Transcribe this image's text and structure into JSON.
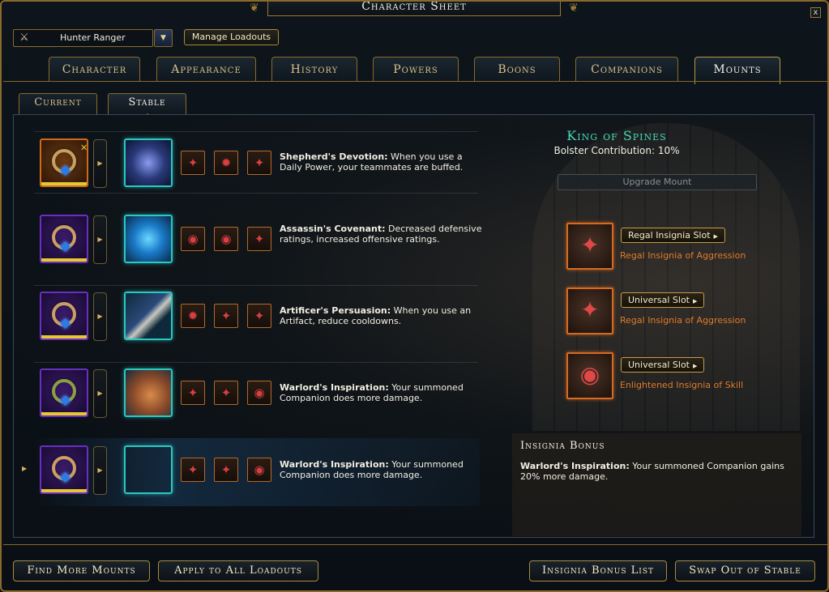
{
  "window": {
    "title": "Character Sheet",
    "close_glyph": "x"
  },
  "loadout": {
    "selected": "Hunter Ranger",
    "manage_label": "Manage Loadouts"
  },
  "tabs": [
    {
      "label": "Character"
    },
    {
      "label": "Appearance"
    },
    {
      "label": "History"
    },
    {
      "label": "Powers"
    },
    {
      "label": "Boons"
    },
    {
      "label": "Companions"
    },
    {
      "label": "Mounts",
      "active": true
    }
  ],
  "subtabs": [
    {
      "label": "Current"
    },
    {
      "label": "Stable",
      "active": true
    }
  ],
  "mounts": [
    {
      "power_name": "Shepherd's Devotion:",
      "power_text": " When you use a Daily Power, your teammates are buffed.",
      "equip_rarity": "orange",
      "icon": "magic-mount-icon",
      "insignia": [
        "✦",
        "✹",
        "✦"
      ]
    },
    {
      "power_name": "Assassin's Covenant:",
      "power_text": " Decreased defensive ratings, increased offensive ratings.",
      "equip_rarity": "purple",
      "icon": "portal-mount-icon",
      "insignia": [
        "◉",
        "◉",
        "✦"
      ]
    },
    {
      "power_name": "Artificer's Persuasion:",
      "power_text": " When you use an Artifact, reduce cooldowns.",
      "equip_rarity": "purple",
      "icon": "carpet-mount-icon",
      "insignia": [
        "✹",
        "✦",
        "✦"
      ]
    },
    {
      "power_name": "Warlord's Inspiration:",
      "power_text": " Your summoned Companion does more damage.",
      "equip_rarity": "purple",
      "icon": "dinosaur-mount-icon",
      "insignia": [
        "✦",
        "✦",
        "◉"
      ]
    },
    {
      "power_name": "Warlord's Inspiration:",
      "power_text": " Your summoned Companion does more damage.",
      "equip_rarity": "purple",
      "icon": "dinosaur-mount-icon",
      "insignia": [
        "✦",
        "✦",
        "◉"
      ],
      "selected": true
    }
  ],
  "detail": {
    "mount_name": "King of Spines",
    "bolster": "Bolster Contribution: 10%",
    "upgrade_label": "Upgrade Mount",
    "slots": [
      {
        "slot_label": "Regal Insignia Slot",
        "insignia_name": "Regal Insignia of Aggression",
        "glyph": "✦"
      },
      {
        "slot_label": "Universal Slot",
        "insignia_name": "Regal Insignia of Aggression",
        "glyph": "✦"
      },
      {
        "slot_label": "Universal Slot",
        "insignia_name": "Enlightened Insignia of Skill",
        "glyph": "◉"
      }
    ],
    "bonus_title": "Insignia Bonus",
    "bonus_name": "Warlord's Inspiration:",
    "bonus_text": " Your summoned Companion gains 20% more damage."
  },
  "bottom": {
    "find_more": "Find More Mounts",
    "apply_all": "Apply to All Loadouts",
    "bonus_list": "Insignia Bonus List",
    "swap_out": "Swap Out of Stable"
  },
  "colors": {
    "accent_gold": "#8a6a2a",
    "mount_name": "#4ad8b8",
    "insignia_orange": "#e07a28"
  }
}
